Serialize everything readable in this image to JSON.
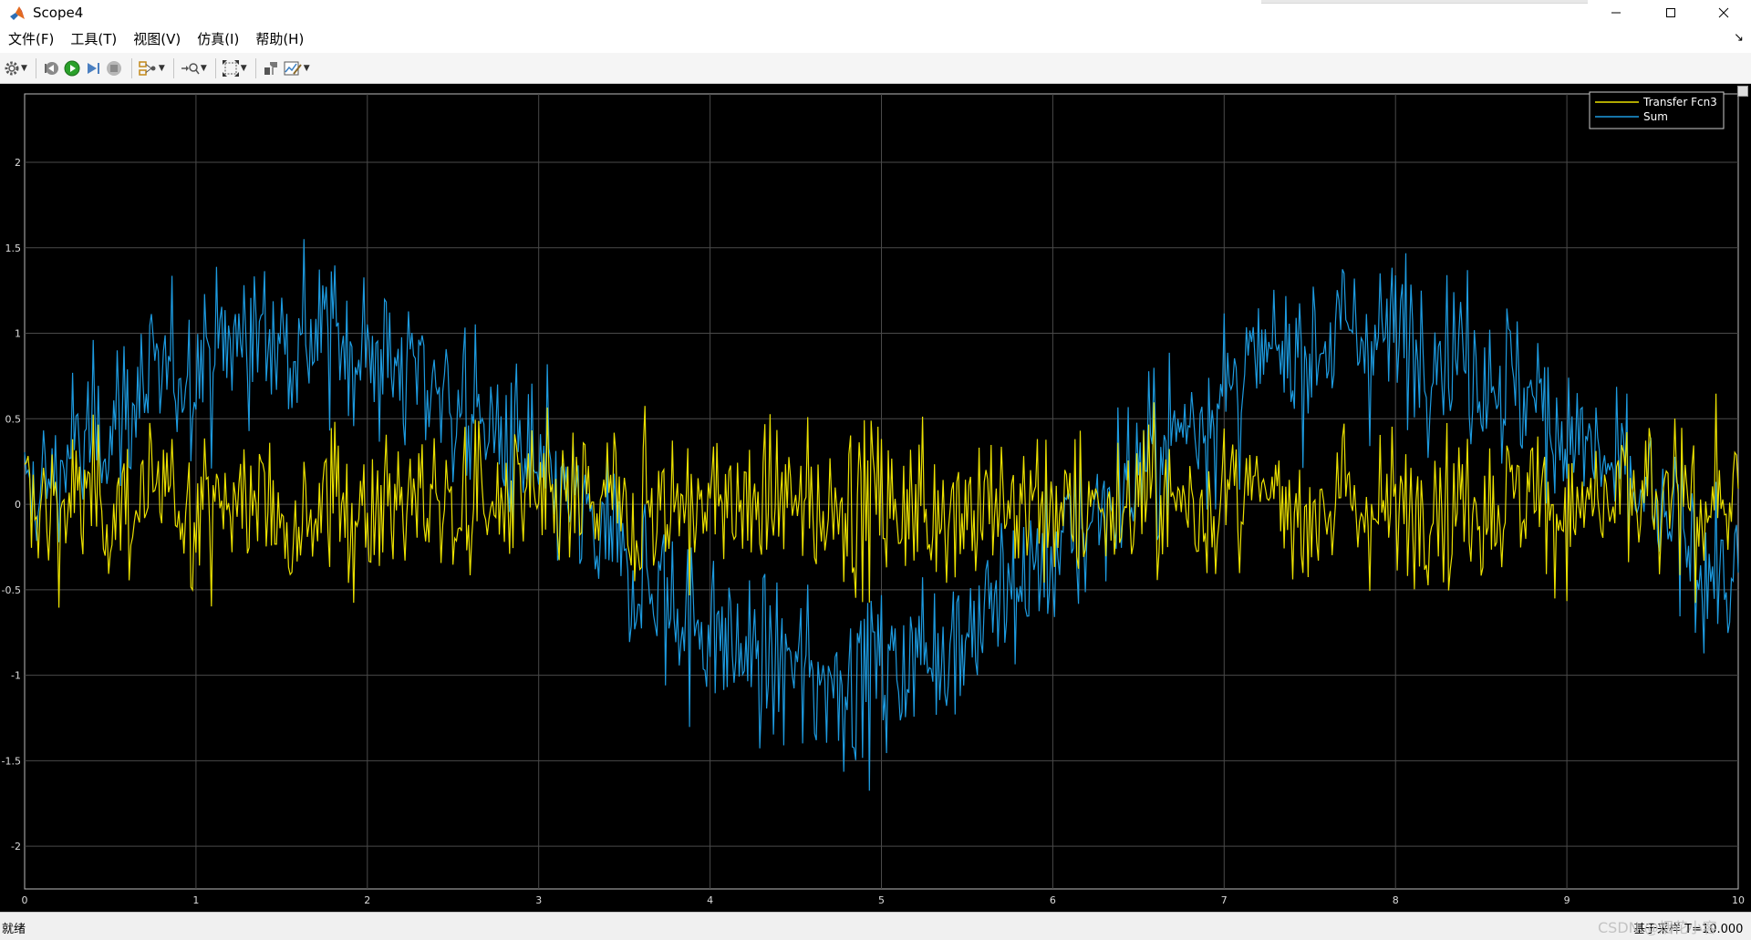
{
  "window": {
    "title": "Scope4",
    "icon": "matlab-logo-icon"
  },
  "menu": [
    "文件(F)",
    "工具(T)",
    "视图(V)",
    "仿真(I)",
    "帮助(H)"
  ],
  "toolbar": {
    "buttons": [
      "settings-icon",
      "step-back-icon",
      "run-icon",
      "step-forward-icon",
      "stop-icon",
      "signal-select-icon",
      "zoom-icon",
      "autoscale-icon",
      "highlight-icon",
      "style-icon"
    ]
  },
  "status": {
    "text": "就绪",
    "right_text": "基于采样 T=10.000"
  },
  "watermark": "CSDN @烟花小客",
  "colors": {
    "background": "#000000",
    "grid": "#4a4a4a",
    "tick_text": "#dddddd",
    "series1": "#ebe100",
    "series2": "#1d9be0"
  },
  "chart_data": {
    "type": "line",
    "xlim": [
      0,
      10
    ],
    "ylim": [
      -2.25,
      2.4
    ],
    "xticks": [
      0,
      1,
      2,
      3,
      4,
      5,
      6,
      7,
      8,
      9,
      10
    ],
    "xtick_labels": [
      "0",
      "1",
      "2",
      "3",
      "4",
      "5",
      "6",
      "7",
      "8",
      "9",
      "10"
    ],
    "yticks": [
      2,
      1.5,
      1,
      0.5,
      0,
      -0.5,
      -1,
      -1.5,
      -2
    ],
    "ytick_labels": [
      "2",
      "1.5",
      "1",
      "0.5",
      "0",
      "-0.5",
      "-1",
      "-1.5",
      "-2"
    ],
    "grid": true,
    "legend_position": "top-right",
    "series": [
      {
        "name": "Transfer Fcn3",
        "color": "#ebe100",
        "description_points": "zero-mean noise, approx ±0.6, t step 0.01",
        "x_range": [
          0,
          10
        ],
        "amplitude": 0.33,
        "mean": 0
      },
      {
        "name": "Sum",
        "color": "#1d9be0",
        "x_range": [
          0,
          10
        ],
        "base_sine_amplitude": 1.0,
        "base_sine_period": 6.3,
        "noise_amplitude": 0.35
      }
    ]
  }
}
